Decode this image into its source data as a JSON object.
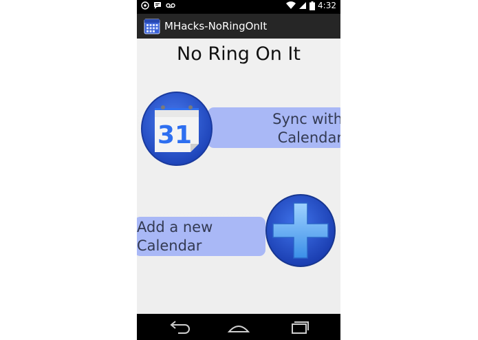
{
  "app": {
    "title": "MHacks-NoRingOnIt"
  },
  "status_bar": {
    "time": "4:32",
    "left_icons": [
      "hangouts-icon",
      "talk-icon",
      "voicemail-icon"
    ],
    "right_icons": [
      "wifi-icon",
      "signal-icon",
      "battery-icon"
    ]
  },
  "main": {
    "title": "No Ring On It",
    "sync_label": "Sync with\nCalendar",
    "sync_icon_day": "31",
    "add_label": "Add a new\n Calendar"
  },
  "nav_bar": {
    "buttons": [
      "back-icon",
      "home-icon",
      "recents-icon"
    ]
  },
  "colors": {
    "pill": "#a9b8f6",
    "circle_blue": "#2b57d6",
    "action_bar": "#262626"
  }
}
